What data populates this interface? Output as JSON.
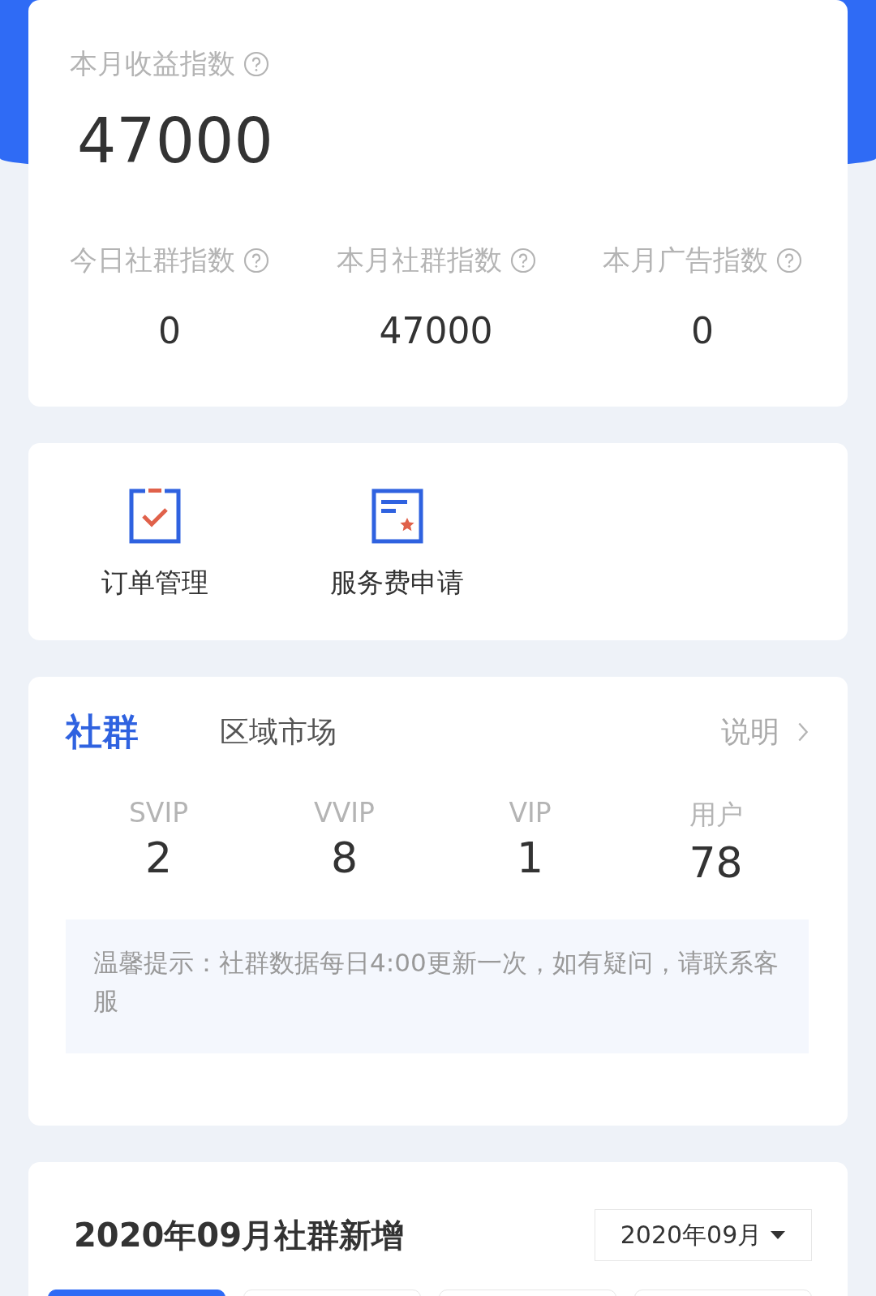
{
  "income": {
    "title": "本月收益指数",
    "value": "47000"
  },
  "metrics": [
    {
      "label": "今日社群指数",
      "value": "0"
    },
    {
      "label": "本月社群指数",
      "value": "47000"
    },
    {
      "label": "本月广告指数",
      "value": "0"
    }
  ],
  "shortcuts": [
    {
      "kind": "order",
      "label": "订单管理"
    },
    {
      "kind": "fee",
      "label": "服务费申请"
    }
  ],
  "community": {
    "tabs": [
      {
        "label": "社群",
        "selected": true
      },
      {
        "label": "区域市场",
        "selected": false
      }
    ],
    "help_link": "说明",
    "stats": [
      {
        "label": "SVIP",
        "value": "2"
      },
      {
        "label": "VVIP",
        "value": "8"
      },
      {
        "label": "VIP",
        "value": "1"
      },
      {
        "label": "用户",
        "value": "78"
      }
    ],
    "notice": "温馨提示：社群数据每日4:00更新一次，如有疑问，请联系客服"
  },
  "growth": {
    "title": "2020年09月社群新增",
    "month_picker": "2020年09月",
    "tabs": [
      {
        "selected": true
      },
      {
        "selected": false
      },
      {
        "selected": false
      },
      {
        "selected": false
      }
    ]
  }
}
